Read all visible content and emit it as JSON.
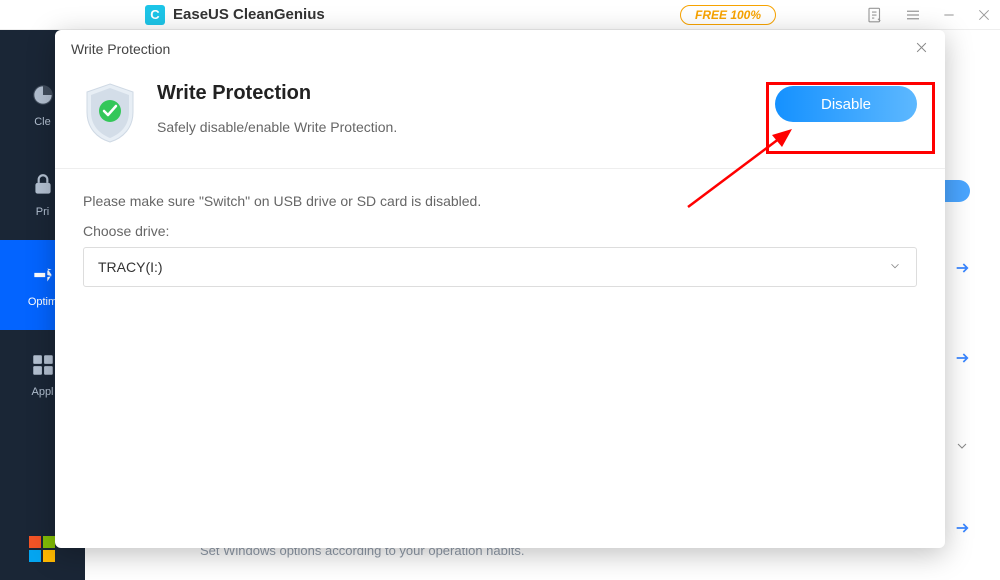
{
  "app": {
    "title": "EaseUS CleanGenius",
    "logo_letter": "C",
    "free_badge": "FREE 100%"
  },
  "sidebar": {
    "items": [
      {
        "label": "Cle"
      },
      {
        "label": "Pri"
      },
      {
        "label": "Optim"
      },
      {
        "label": "Appl"
      }
    ]
  },
  "main": {
    "hint": "Set Windows options according to your operation habits."
  },
  "modal": {
    "title": "Write Protection",
    "header_title": "Write Protection",
    "header_description": "Safely disable/enable Write Protection.",
    "disable_button": "Disable",
    "instruction": "Please make sure \"Switch\" on USB drive or SD card is disabled.",
    "choose_drive_label": "Choose drive:",
    "selected_drive": "TRACY(I:)"
  }
}
